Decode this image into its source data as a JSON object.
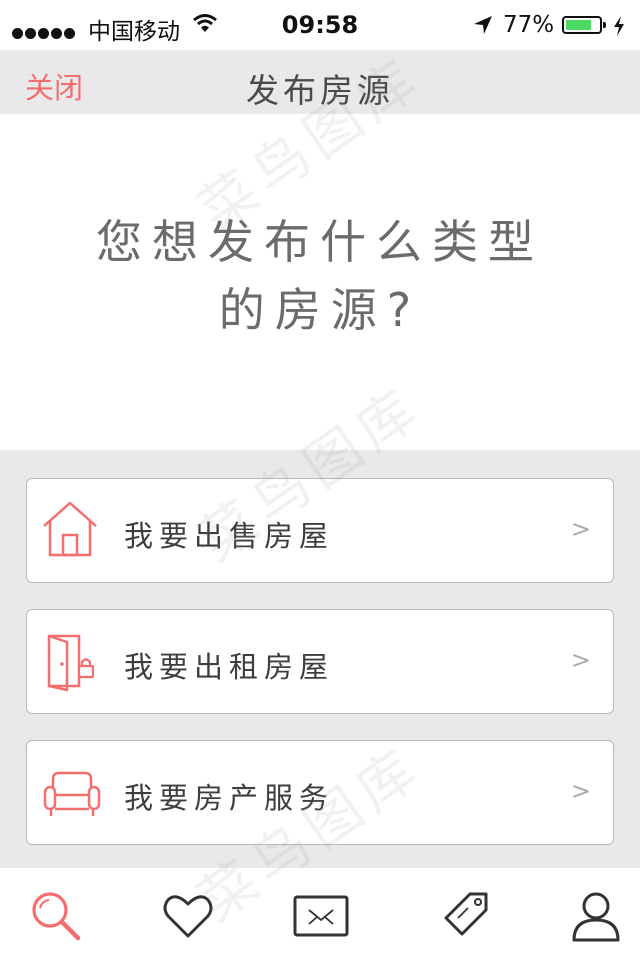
{
  "status_bar": {
    "carrier": "中国移动",
    "time": "09:58",
    "battery_percent": "77%",
    "battery_level": 0.77,
    "icons": [
      "signal-dots-icon",
      "wifi-icon",
      "location-arrow-icon",
      "battery-icon",
      "charging-bolt-icon"
    ]
  },
  "nav": {
    "close_label": "关闭",
    "title": "发布房源"
  },
  "hero": {
    "question_line1": "您想发布什么类型",
    "question_line2": "的房源?"
  },
  "options": [
    {
      "label": "我要出售房屋",
      "icon": "house-icon",
      "chevron": ">"
    },
    {
      "label": "我要出租房屋",
      "icon": "door-lock-icon",
      "chevron": ">"
    },
    {
      "label": "我要房产服务",
      "icon": "sofa-icon",
      "chevron": ">"
    }
  ],
  "tabs": [
    {
      "icon": "search-icon",
      "active": true
    },
    {
      "icon": "heart-icon",
      "active": false
    },
    {
      "icon": "mail-icon",
      "active": false
    },
    {
      "icon": "tag-icon",
      "active": false
    },
    {
      "icon": "user-icon",
      "active": false
    }
  ],
  "watermark": "菜鸟图库",
  "colors": {
    "accent": "#f36e6e",
    "nav_bg": "#eae9ea",
    "battery_green": "#4cd964",
    "tab_icon": "#333333"
  }
}
